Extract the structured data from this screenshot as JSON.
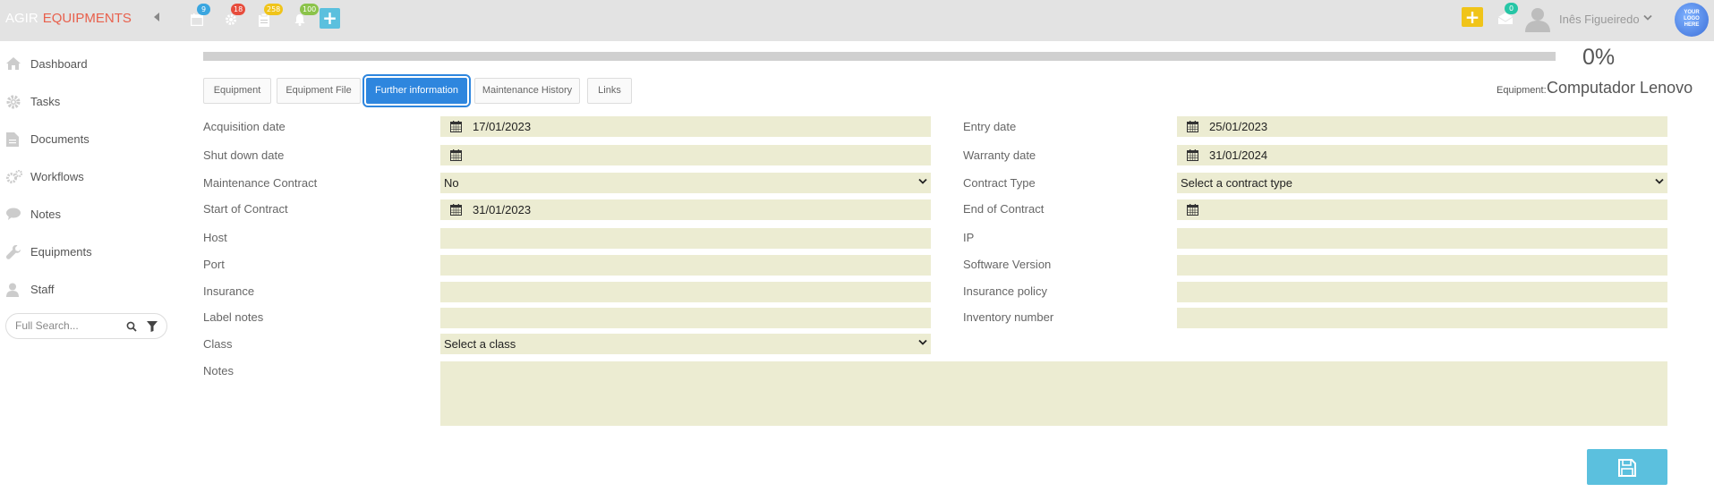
{
  "brand": {
    "part1": "AGIR",
    "part2": "EQUIPMENTS"
  },
  "topbar": {
    "badges": {
      "calendar": "9",
      "settings": "18",
      "clipboard": "258",
      "bell": "100",
      "mail": "0"
    },
    "badge_colors": {
      "calendar": "#3aa6e0",
      "settings": "#e74c3c",
      "clipboard": "#f0c419",
      "bell": "#8bc34a",
      "mail": "#26c6a6"
    },
    "user_name": "Inês Figueiredo",
    "logo_text": [
      "YOUR",
      "LOGO",
      "HERE"
    ]
  },
  "sidebar": {
    "items": [
      {
        "label": "Dashboard",
        "icon": "home-icon"
      },
      {
        "label": "Tasks",
        "icon": "gear-icon"
      },
      {
        "label": "Documents",
        "icon": "document-icon"
      },
      {
        "label": "Workflows",
        "icon": "workflow-icon"
      },
      {
        "label": "Notes",
        "icon": "comment-icon"
      },
      {
        "label": "Equipments",
        "icon": "wrench-icon"
      },
      {
        "label": "Staff",
        "icon": "user-icon"
      }
    ],
    "search_placeholder": "Full Search..."
  },
  "progress": {
    "value": 0,
    "label": "0%"
  },
  "tabs": [
    {
      "label": "Equipment"
    },
    {
      "label": "Equipment File"
    },
    {
      "label": "Further information",
      "active": true
    },
    {
      "label": "Maintenance History"
    },
    {
      "label": "Links"
    }
  ],
  "equipment": {
    "label": "Equipment:",
    "name": "Computador Lenovo"
  },
  "form": {
    "acquisition_date": {
      "label": "Acquisition date",
      "value": "17/01/2023"
    },
    "entry_date": {
      "label": "Entry date",
      "value": "25/01/2023"
    },
    "shut_down_date": {
      "label": "Shut down date",
      "value": ""
    },
    "warranty_date": {
      "label": "Warranty date",
      "value": "31/01/2024"
    },
    "maintenance_contract": {
      "label": "Maintenance Contract",
      "value": "No"
    },
    "contract_type": {
      "label": "Contract Type",
      "value": "Select a contract type"
    },
    "start_of_contract": {
      "label": "Start of Contract",
      "value": "31/01/2023"
    },
    "end_of_contract": {
      "label": "End of Contract",
      "value": ""
    },
    "host": {
      "label": "Host",
      "value": ""
    },
    "ip": {
      "label": "IP",
      "value": ""
    },
    "port": {
      "label": "Port",
      "value": ""
    },
    "software_version": {
      "label": "Software Version",
      "value": ""
    },
    "insurance": {
      "label": "Insurance",
      "value": ""
    },
    "insurance_policy": {
      "label": "Insurance policy",
      "value": ""
    },
    "label_notes": {
      "label": "Label notes",
      "value": ""
    },
    "inventory_number": {
      "label": "Inventory number",
      "value": ""
    },
    "class": {
      "label": "Class",
      "value": "Select a class"
    },
    "notes": {
      "label": "Notes",
      "value": ""
    }
  },
  "colors": {
    "accent": "#2e86de",
    "field_bg": "#ececd2",
    "save_button": "#5bc0de",
    "brand_red": "#e8604c"
  }
}
